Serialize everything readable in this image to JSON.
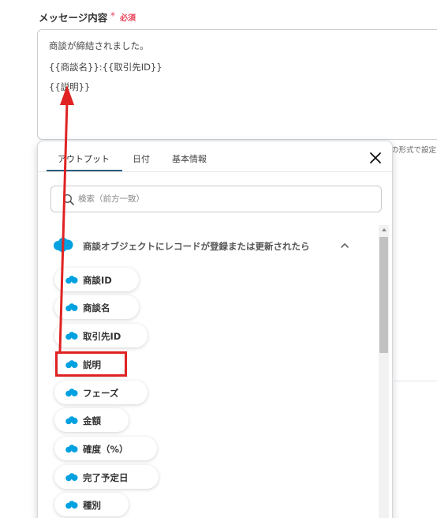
{
  "field": {
    "label": "メッセージ内容",
    "required_mark": "*",
    "required_text": "必須",
    "lines": [
      "商談が締結されました。",
      "{{商談名}}:{{取引先ID}}",
      "{{説明}}"
    ],
    "side_hint": "の形式で設定"
  },
  "popover": {
    "tabs": [
      {
        "label": "アウトプット",
        "active": true
      },
      {
        "label": "日付",
        "active": false
      },
      {
        "label": "基本情報",
        "active": false
      }
    ],
    "close_label": "×",
    "search": {
      "placeholder": "検索（前方一致）",
      "value": ""
    },
    "section": {
      "title": "商談オブジェクトにレコードが登録または更新されたら",
      "icon": "salesforce-cloud-icon",
      "expanded": true
    },
    "items": [
      {
        "label": "商談ID"
      },
      {
        "label": "商談名"
      },
      {
        "label": "取引先ID"
      },
      {
        "label": "説明",
        "highlighted": true
      },
      {
        "label": "フェーズ"
      },
      {
        "label": "金額"
      },
      {
        "label": "確度（%）"
      },
      {
        "label": "完了予定日"
      },
      {
        "label": "種別"
      }
    ]
  },
  "colors": {
    "accent_underline": "#2b5d7c",
    "salesforce_blue": "#00a1e0",
    "required": "#e8445a",
    "annotation_red": "#e02222"
  }
}
